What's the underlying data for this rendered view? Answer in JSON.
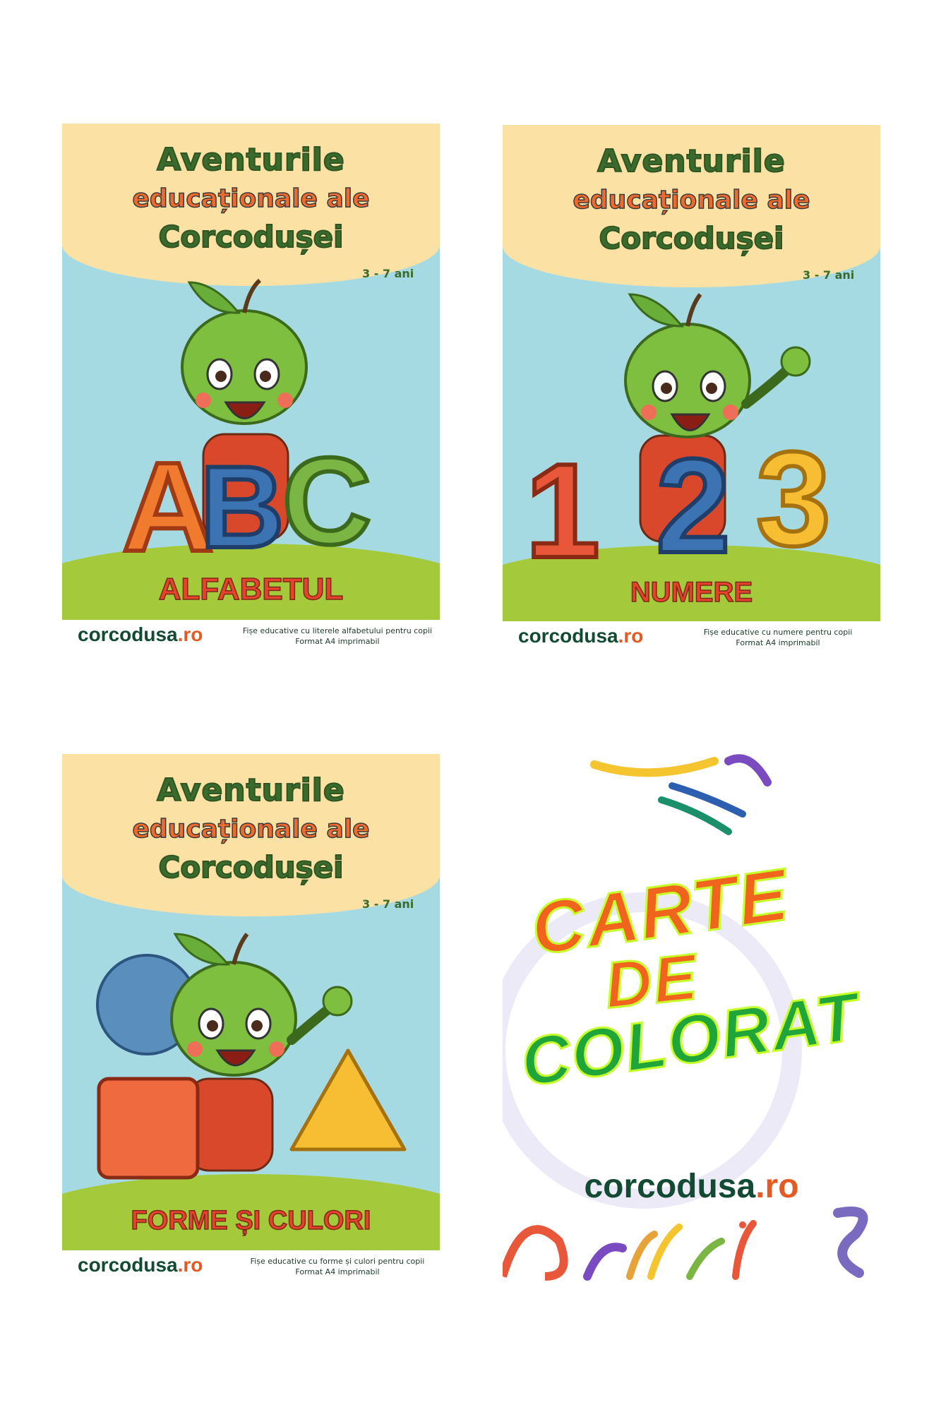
{
  "covers": [
    {
      "title_line1": "Aventurile",
      "title_line2": "educaționale ale",
      "title_line3": "Corcodușei",
      "age": "3 - 7 ani",
      "subject": "ALFABETUL",
      "big_glyphs": [
        "A",
        "B",
        "C"
      ],
      "brand_name": "corcodusa",
      "brand_tld": ".ro",
      "description_line1": "Fișe educative cu literele alfabetului pentru copii",
      "description_line2": "Format A4 imprimabil"
    },
    {
      "title_line1": "Aventurile",
      "title_line2": "educaționale ale",
      "title_line3": "Corcodușei",
      "age": "3 - 7 ani",
      "subject": "NUMERE",
      "big_glyphs": [
        "1",
        "2",
        "3"
      ],
      "brand_name": "corcodusa",
      "brand_tld": ".ro",
      "description_line1": "Fișe educative cu numere pentru copii",
      "description_line2": "Format A4 imprimabil"
    },
    {
      "title_line1": "Aventurile",
      "title_line2": "educaționale ale",
      "title_line3": "Corcodușei",
      "age": "3 - 7 ani",
      "subject": "FORME ȘI CULORI",
      "brand_name": "corcodusa",
      "brand_tld": ".ro",
      "description_line1": "Fișe educative cu forme și culori pentru copii",
      "description_line2": "Format A4 imprimabil"
    }
  ],
  "coloring_book": {
    "line1": "CARTE",
    "line2": "DE",
    "line3": "COLORAT",
    "brand_name": "corcodusa",
    "brand_tld": ".ro"
  },
  "colors": {
    "sky": "#a6dae2",
    "cream": "#fbe1a4",
    "grass": "#a4c93a",
    "brand_green": "#134a34",
    "brand_orange": "#e55a22"
  },
  "icons": [
    "apple-mascot-icon",
    "circle-shape-icon",
    "square-shape-icon",
    "triangle-shape-icon"
  ]
}
